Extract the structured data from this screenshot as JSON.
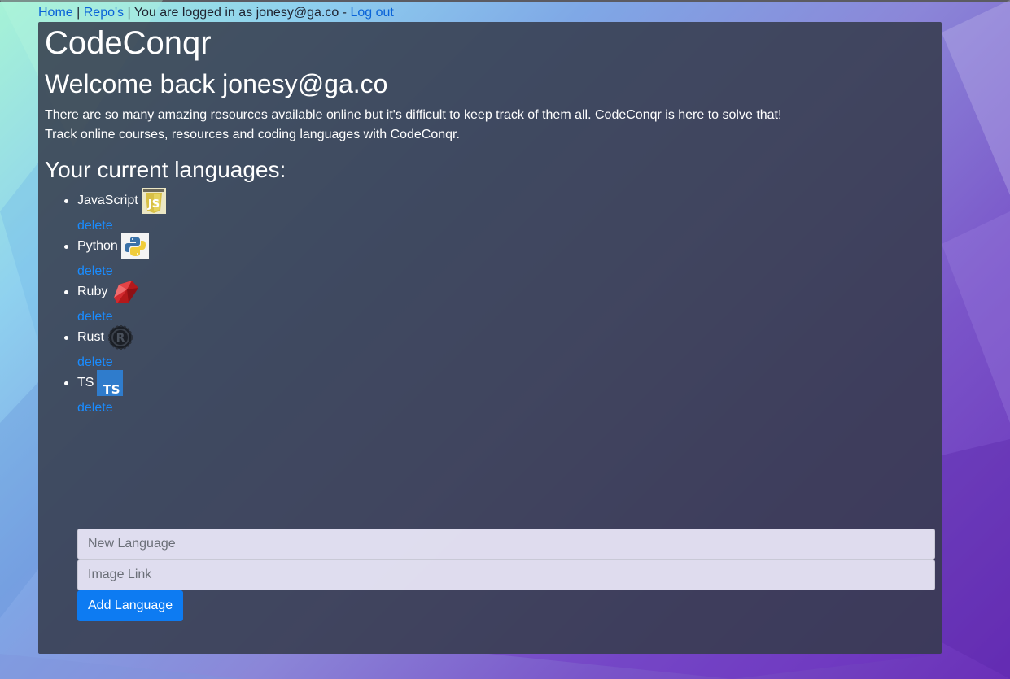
{
  "topnav": {
    "home_label": "Home",
    "separator_1": "|",
    "repos_label": "Repo's",
    "separator_2": "|",
    "logged_in_text": "You are logged in as jonesy@ga.co -",
    "logout_label": "Log out"
  },
  "header": {
    "app_title": "CodeConqr",
    "welcome": "Welcome back jonesy@ga.co"
  },
  "intro": {
    "line_1": "There are so many amazing resources available online but it's difficult to keep track of them all. CodeConqr is here to solve that!",
    "line_2": "Track online courses, resources and coding languages with CodeConqr."
  },
  "languages": {
    "title": "Your current languages:",
    "delete_label": "delete",
    "items": [
      {
        "name": "JavaScript",
        "icon": "javascript-logo-icon"
      },
      {
        "name": "Python",
        "icon": "python-logo-icon"
      },
      {
        "name": "Ruby",
        "icon": "ruby-logo-icon"
      },
      {
        "name": "Rust",
        "icon": "rust-logo-icon"
      },
      {
        "name": "TS",
        "icon": "typescript-logo-icon"
      }
    ]
  },
  "form": {
    "language_placeholder": "New Language",
    "image_placeholder": "Image Link",
    "submit_label": "Add Language"
  },
  "colors": {
    "panel": "#343a4a",
    "link": "#1a8cff",
    "button": "#0d7bf2"
  }
}
